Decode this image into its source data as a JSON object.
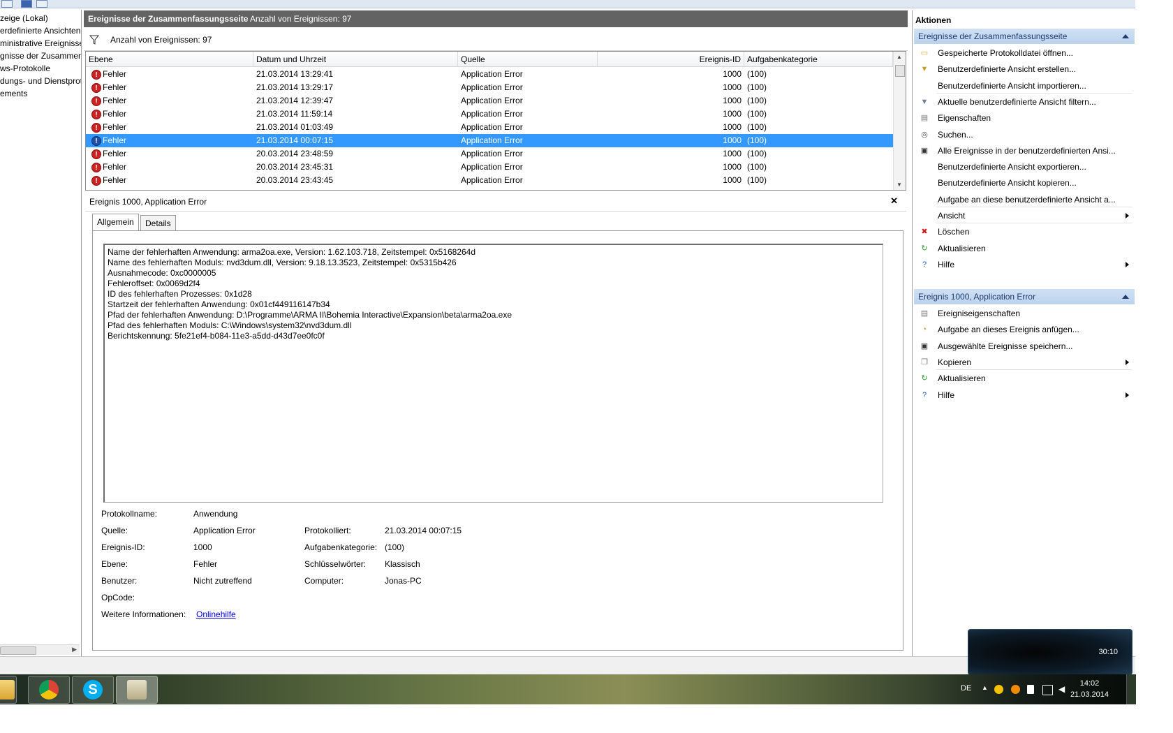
{
  "tree": {
    "nodes": [
      "zeige (Lokal)",
      "erdefinierte Ansichten",
      "ministrative Ereignisse",
      "gnisse der Zusammenf",
      "ws-Protokolle",
      "dungs- und Dienstprot",
      "ements"
    ]
  },
  "center": {
    "title": "Ereignisse der Zusammenfassungsseite",
    "count_label": "Anzahl von Ereignissen: 97",
    "filter_label": "Anzahl von Ereignissen: 97"
  },
  "grid": {
    "headers": [
      "Ebene",
      "Datum und Uhrzeit",
      "Quelle",
      "Ereignis-ID",
      "Aufgabenkategorie"
    ],
    "rows": [
      {
        "level": "Fehler",
        "date": "21.03.2014 13:29:41",
        "source": "Application Error",
        "id": "1000",
        "category": "(100)"
      },
      {
        "level": "Fehler",
        "date": "21.03.2014 13:29:17",
        "source": "Application Error",
        "id": "1000",
        "category": "(100)"
      },
      {
        "level": "Fehler",
        "date": "21.03.2014 12:39:47",
        "source": "Application Error",
        "id": "1000",
        "category": "(100)"
      },
      {
        "level": "Fehler",
        "date": "21.03.2014 11:59:14",
        "source": "Application Error",
        "id": "1000",
        "category": "(100)"
      },
      {
        "level": "Fehler",
        "date": "21.03.2014 01:03:49",
        "source": "Application Error",
        "id": "1000",
        "category": "(100)"
      },
      {
        "level": "Fehler",
        "date": "21.03.2014 00:07:15",
        "source": "Application Error",
        "id": "1000",
        "category": "(100)"
      },
      {
        "level": "Fehler",
        "date": "20.03.2014 23:48:59",
        "source": "Application Error",
        "id": "1000",
        "category": "(100)"
      },
      {
        "level": "Fehler",
        "date": "20.03.2014 23:45:31",
        "source": "Application Error",
        "id": "1000",
        "category": "(100)"
      },
      {
        "level": "Fehler",
        "date": "20.03.2014 23:43:45",
        "source": "Application Error",
        "id": "1000",
        "category": "(100)"
      }
    ],
    "selected_index": 5,
    "error_glyph": "!"
  },
  "detail": {
    "title": "Ereignis 1000, Application Error",
    "close_glyph": "✕",
    "tabs": [
      "Allgemein",
      "Details"
    ],
    "description_lines": [
      "Name der fehlerhaften Anwendung: arma2oa.exe, Version: 1.62.103.718, Zeitstempel: 0x5168264d",
      "Name des fehlerhaften Moduls: nvd3dum.dll, Version: 9.18.13.3523, Zeitstempel: 0x5315b426",
      "Ausnahmecode: 0xc0000005",
      "Fehleroffset: 0x0069d2f4",
      "ID des fehlerhaften Prozesses: 0x1d28",
      "Startzeit der fehlerhaften Anwendung: 0x01cf449116147b34",
      "Pfad der fehlerhaften Anwendung: D:\\Programme\\ARMA II\\Bohemia Interactive\\Expansion\\beta\\arma2oa.exe",
      "Pfad des fehlerhaften Moduls: C:\\Windows\\system32\\nvd3dum.dll",
      "Berichtskennung: 5fe21ef4-b084-11e3-a5dd-d43d7ee0fc0f"
    ],
    "props": {
      "log_label": "Protokollname:",
      "log_value": "Anwendung",
      "source_label": "Quelle:",
      "source_value": "Application Error",
      "logged_label": "Protokolliert:",
      "logged_value": "21.03.2014 00:07:15",
      "eventid_label": "Ereignis-ID:",
      "eventid_value": "1000",
      "taskcat_label": "Aufgabenkategorie:",
      "taskcat_value": "(100)",
      "level_label": "Ebene:",
      "level_value": "Fehler",
      "keywords_label": "Schlüsselwörter:",
      "keywords_value": "Klassisch",
      "user_label": "Benutzer:",
      "user_value": "Nicht zutreffend",
      "computer_label": "Computer:",
      "computer_value": "Jonas-PC",
      "opcode_label": "OpCode:",
      "moreinfo_label": "Weitere Informationen:",
      "moreinfo_link": "Onlinehilfe"
    }
  },
  "actions": {
    "title": "Aktionen",
    "section1": "Ereignisse der Zusammenfassungsseite",
    "items1": [
      {
        "label": "Gespeicherte Protokolldatei öffnen...",
        "icon": "folder-open-icon"
      },
      {
        "label": "Benutzerdefinierte Ansicht erstellen...",
        "icon": "filter-create-icon"
      },
      {
        "label": "Benutzerdefinierte Ansicht importieren...",
        "icon": ""
      },
      {
        "label": "Aktuelle benutzerdefinierte Ansicht filtern...",
        "icon": "filter-icon"
      },
      {
        "label": "Eigenschaften",
        "icon": "properties-icon"
      },
      {
        "label": "Suchen...",
        "icon": "binoculars-icon"
      },
      {
        "label": "Alle Ereignisse in der benutzerdefinierten Ansi...",
        "icon": "save-icon"
      },
      {
        "label": "Benutzerdefinierte Ansicht exportieren...",
        "icon": ""
      },
      {
        "label": "Benutzerdefinierte Ansicht kopieren...",
        "icon": ""
      },
      {
        "label": "Aufgabe an diese benutzerdefinierte Ansicht a...",
        "icon": ""
      },
      {
        "label": "Ansicht",
        "icon": ""
      },
      {
        "label": "Löschen",
        "icon": "delete-icon"
      },
      {
        "label": "Aktualisieren",
        "icon": "refresh-icon"
      },
      {
        "label": "Hilfe",
        "icon": "help-icon"
      }
    ],
    "section2": "Ereignis 1000, Application Error",
    "items2": [
      {
        "label": "Ereigniseigenschaften",
        "icon": "properties-icon"
      },
      {
        "label": "Aufgabe an dieses Ereignis anfügen...",
        "icon": "task-icon"
      },
      {
        "label": "Ausgewählte Ereignisse speichern...",
        "icon": "save-icon"
      },
      {
        "label": "Kopieren",
        "icon": "copy-icon"
      },
      {
        "label": "Aktualisieren",
        "icon": "refresh-icon"
      },
      {
        "label": "Hilfe",
        "icon": "help-icon"
      }
    ]
  },
  "taskbar": {
    "lang": "DE",
    "time": "14:02",
    "date": "21.03.2014",
    "popup_time": "30:10"
  },
  "colors": {
    "selection": "#3399ff",
    "header_bg": "#636363",
    "action_section": "#c5daf1",
    "error_red": "#cc2222"
  }
}
